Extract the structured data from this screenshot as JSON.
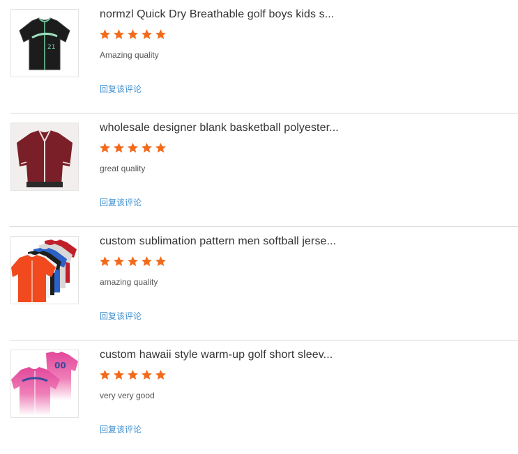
{
  "reviews": [
    {
      "title": "normzl Quick Dry Breathable golf boys kids s...",
      "rating": 5,
      "comment": "Amazing quality",
      "reply_label": "回复该评论",
      "image_icon": "black-baseball-jersey"
    },
    {
      "title": "wholesale designer blank basketball polyester...",
      "rating": 5,
      "comment": "great quality",
      "reply_label": "回复该评论",
      "image_icon": "maroon-baseball-jersey"
    },
    {
      "title": "custom sublimation pattern men softball jerse...",
      "rating": 5,
      "comment": "amazing quality",
      "reply_label": "回复该评论",
      "image_icon": "multicolor-softball-jerseys"
    },
    {
      "title": "custom hawaii style warm-up golf short sleev...",
      "rating": 5,
      "comment": "very very good",
      "reply_label": "回复该评论",
      "image_icon": "pink-gradient-baseball-jersey"
    }
  ],
  "colors": {
    "star": "#f26b1d",
    "reply_link": "#3f8fd0",
    "title": "#333333",
    "divider": "#d9d9d9"
  }
}
